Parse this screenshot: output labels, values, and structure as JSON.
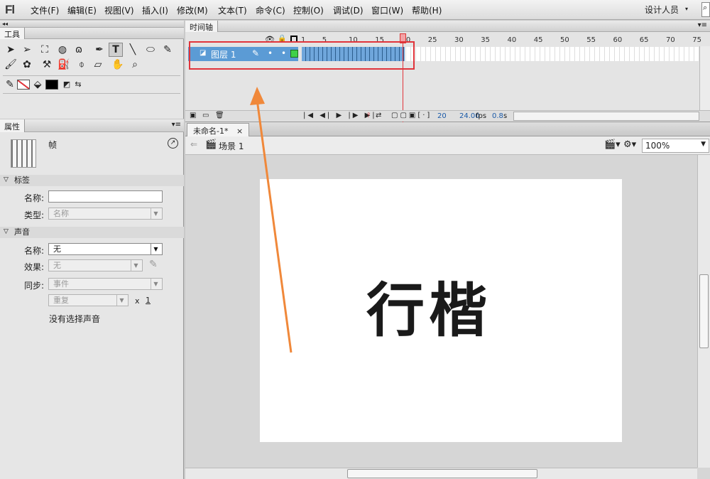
{
  "app": {
    "logo": "Fl",
    "workspace": "设计人员",
    "search_icon": "search-icon"
  },
  "menu": [
    {
      "label": "文件(F)"
    },
    {
      "label": "编辑(E)"
    },
    {
      "label": "视图(V)"
    },
    {
      "label": "插入(I)"
    },
    {
      "label": "修改(M)"
    },
    {
      "label": "文本(T)"
    },
    {
      "label": "命令(C)"
    },
    {
      "label": "控制(O)"
    },
    {
      "label": "调试(D)"
    },
    {
      "label": "窗口(W)"
    },
    {
      "label": "帮助(H)"
    }
  ],
  "tools_panel": {
    "title": "工具"
  },
  "properties": {
    "title": "属性",
    "item_type": "帧",
    "label_section": "标签",
    "name_label": "名称:",
    "name_value": "",
    "type_label": "类型:",
    "type_value": "名称",
    "sound_section": "声音",
    "sound_name_label": "名称:",
    "sound_name_value": "无",
    "effect_label": "效果:",
    "effect_value": "无",
    "sync_label": "同步:",
    "sync_value": "事件",
    "repeat_value": "重复",
    "repeat_x": "x",
    "repeat_count": "1",
    "no_sound": "没有选择声音"
  },
  "timeline": {
    "title": "时间轴",
    "layer_name": "图层 1",
    "ticks": [
      "1",
      "5",
      "10",
      "15",
      "20",
      "25",
      "30",
      "35",
      "40",
      "45",
      "50",
      "55",
      "60",
      "65",
      "70",
      "75"
    ],
    "filled_frames": 20,
    "current_frame": "20",
    "fps": "24.00",
    "fps_unit": "fps",
    "time": "0.8",
    "time_unit": "s"
  },
  "document": {
    "tab_label": "未命名-1*",
    "tab_close": "×",
    "scene": "场景 1",
    "zoom": "100%",
    "canvas_text": "行楷"
  },
  "colors": {
    "accent_red": "#e0343b",
    "layer_blue": "#5b9bd5",
    "arrow_orange": "#f0883a"
  }
}
